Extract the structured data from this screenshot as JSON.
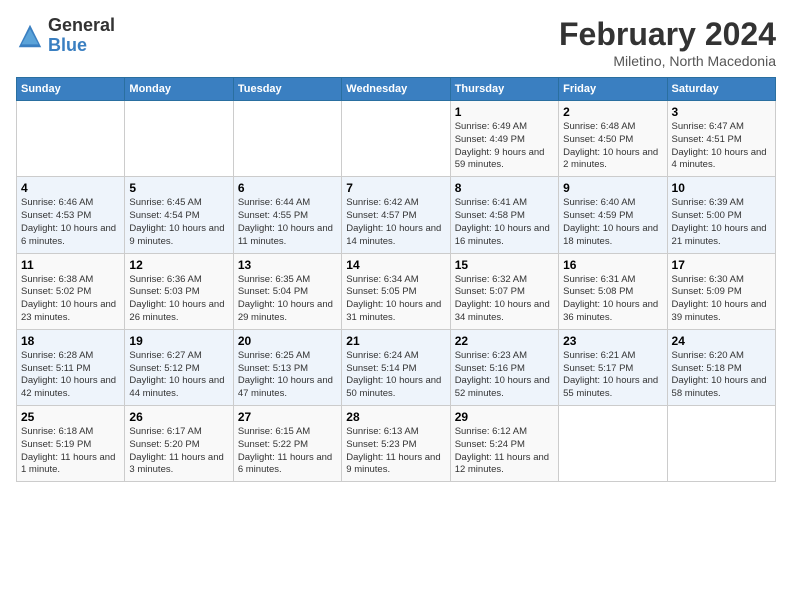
{
  "logo": {
    "general": "General",
    "blue": "Blue"
  },
  "header": {
    "title": "February 2024",
    "subtitle": "Miletino, North Macedonia"
  },
  "weekdays": [
    "Sunday",
    "Monday",
    "Tuesday",
    "Wednesday",
    "Thursday",
    "Friday",
    "Saturday"
  ],
  "weeks": [
    [
      {
        "day": "",
        "info": ""
      },
      {
        "day": "",
        "info": ""
      },
      {
        "day": "",
        "info": ""
      },
      {
        "day": "",
        "info": ""
      },
      {
        "day": "1",
        "info": "Sunrise: 6:49 AM\nSunset: 4:49 PM\nDaylight: 9 hours and 59 minutes."
      },
      {
        "day": "2",
        "info": "Sunrise: 6:48 AM\nSunset: 4:50 PM\nDaylight: 10 hours and 2 minutes."
      },
      {
        "day": "3",
        "info": "Sunrise: 6:47 AM\nSunset: 4:51 PM\nDaylight: 10 hours and 4 minutes."
      }
    ],
    [
      {
        "day": "4",
        "info": "Sunrise: 6:46 AM\nSunset: 4:53 PM\nDaylight: 10 hours and 6 minutes."
      },
      {
        "day": "5",
        "info": "Sunrise: 6:45 AM\nSunset: 4:54 PM\nDaylight: 10 hours and 9 minutes."
      },
      {
        "day": "6",
        "info": "Sunrise: 6:44 AM\nSunset: 4:55 PM\nDaylight: 10 hours and 11 minutes."
      },
      {
        "day": "7",
        "info": "Sunrise: 6:42 AM\nSunset: 4:57 PM\nDaylight: 10 hours and 14 minutes."
      },
      {
        "day": "8",
        "info": "Sunrise: 6:41 AM\nSunset: 4:58 PM\nDaylight: 10 hours and 16 minutes."
      },
      {
        "day": "9",
        "info": "Sunrise: 6:40 AM\nSunset: 4:59 PM\nDaylight: 10 hours and 18 minutes."
      },
      {
        "day": "10",
        "info": "Sunrise: 6:39 AM\nSunset: 5:00 PM\nDaylight: 10 hours and 21 minutes."
      }
    ],
    [
      {
        "day": "11",
        "info": "Sunrise: 6:38 AM\nSunset: 5:02 PM\nDaylight: 10 hours and 23 minutes."
      },
      {
        "day": "12",
        "info": "Sunrise: 6:36 AM\nSunset: 5:03 PM\nDaylight: 10 hours and 26 minutes."
      },
      {
        "day": "13",
        "info": "Sunrise: 6:35 AM\nSunset: 5:04 PM\nDaylight: 10 hours and 29 minutes."
      },
      {
        "day": "14",
        "info": "Sunrise: 6:34 AM\nSunset: 5:05 PM\nDaylight: 10 hours and 31 minutes."
      },
      {
        "day": "15",
        "info": "Sunrise: 6:32 AM\nSunset: 5:07 PM\nDaylight: 10 hours and 34 minutes."
      },
      {
        "day": "16",
        "info": "Sunrise: 6:31 AM\nSunset: 5:08 PM\nDaylight: 10 hours and 36 minutes."
      },
      {
        "day": "17",
        "info": "Sunrise: 6:30 AM\nSunset: 5:09 PM\nDaylight: 10 hours and 39 minutes."
      }
    ],
    [
      {
        "day": "18",
        "info": "Sunrise: 6:28 AM\nSunset: 5:11 PM\nDaylight: 10 hours and 42 minutes."
      },
      {
        "day": "19",
        "info": "Sunrise: 6:27 AM\nSunset: 5:12 PM\nDaylight: 10 hours and 44 minutes."
      },
      {
        "day": "20",
        "info": "Sunrise: 6:25 AM\nSunset: 5:13 PM\nDaylight: 10 hours and 47 minutes."
      },
      {
        "day": "21",
        "info": "Sunrise: 6:24 AM\nSunset: 5:14 PM\nDaylight: 10 hours and 50 minutes."
      },
      {
        "day": "22",
        "info": "Sunrise: 6:23 AM\nSunset: 5:16 PM\nDaylight: 10 hours and 52 minutes."
      },
      {
        "day": "23",
        "info": "Sunrise: 6:21 AM\nSunset: 5:17 PM\nDaylight: 10 hours and 55 minutes."
      },
      {
        "day": "24",
        "info": "Sunrise: 6:20 AM\nSunset: 5:18 PM\nDaylight: 10 hours and 58 minutes."
      }
    ],
    [
      {
        "day": "25",
        "info": "Sunrise: 6:18 AM\nSunset: 5:19 PM\nDaylight: 11 hours and 1 minute."
      },
      {
        "day": "26",
        "info": "Sunrise: 6:17 AM\nSunset: 5:20 PM\nDaylight: 11 hours and 3 minutes."
      },
      {
        "day": "27",
        "info": "Sunrise: 6:15 AM\nSunset: 5:22 PM\nDaylight: 11 hours and 6 minutes."
      },
      {
        "day": "28",
        "info": "Sunrise: 6:13 AM\nSunset: 5:23 PM\nDaylight: 11 hours and 9 minutes."
      },
      {
        "day": "29",
        "info": "Sunrise: 6:12 AM\nSunset: 5:24 PM\nDaylight: 11 hours and 12 minutes."
      },
      {
        "day": "",
        "info": ""
      },
      {
        "day": "",
        "info": ""
      }
    ]
  ]
}
